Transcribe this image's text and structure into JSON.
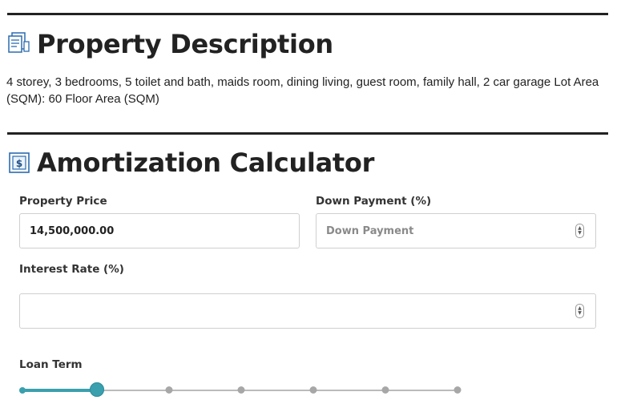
{
  "description_section": {
    "title": "Property Description",
    "text": "4 storey, 3 bedrooms, 5 toilet and bath, maids room, dining living, guest room, family hall, 2 car garage Lot Area (SQM): 60 Floor Area (SQM)"
  },
  "calculator": {
    "title": "Amortization Calculator",
    "property_price": {
      "label": "Property Price",
      "value": "14,500,000.00"
    },
    "down_payment": {
      "label": "Down Payment (%)",
      "placeholder": "Down Payment",
      "value": ""
    },
    "interest_rate": {
      "label": "Interest Rate (%)",
      "value": ""
    },
    "loan_term": {
      "label": "Loan Term",
      "steps": 7,
      "selected_index": 1
    }
  },
  "colors": {
    "accent": "#3aa0ae",
    "rule": "#222222",
    "icon_blue": "#2b6cb0"
  }
}
